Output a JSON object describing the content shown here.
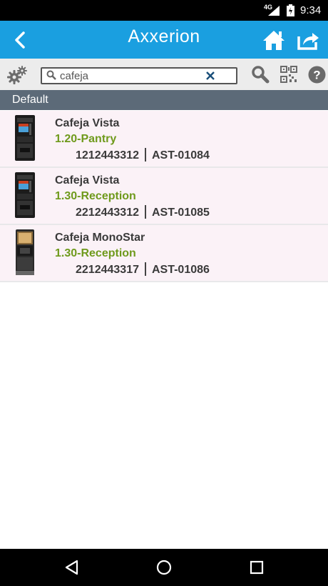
{
  "status_bar": {
    "network": "4G",
    "time": "9:34"
  },
  "app_bar": {
    "logo_text": "Axxerion"
  },
  "search": {
    "value": "cafeja"
  },
  "group": {
    "title": "Default"
  },
  "items": [
    {
      "name": "Cafeja Vista",
      "location": "1.20-Pantry",
      "serial": "1212443312",
      "asset": "AST-01084"
    },
    {
      "name": "Cafeja Vista",
      "location": "1.30-Reception",
      "serial": "2212443312",
      "asset": "AST-01085"
    },
    {
      "name": "Cafeja MonoStar",
      "location": "1.30-Reception",
      "serial": "2212443317",
      "asset": "AST-01086"
    }
  ],
  "colors": {
    "app_bar": "#1a9fe0",
    "group_header": "#5c6a78",
    "location_text": "#6f9a1c",
    "item_background": "#fbf2f7"
  }
}
